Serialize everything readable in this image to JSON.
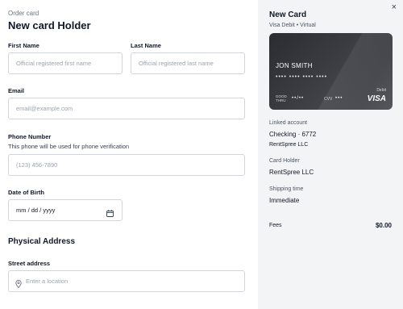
{
  "form": {
    "breadcrumb": "Order card",
    "title": "New card Holder",
    "first_name": {
      "label": "First Name",
      "placeholder": "Official registered first name"
    },
    "last_name": {
      "label": "Last Name",
      "placeholder": "Official registered last name"
    },
    "email": {
      "label": "Email",
      "placeholder": "email@example.com"
    },
    "phone": {
      "label": "Phone Number",
      "help": "This phone will be used for phone verification",
      "placeholder": "(123) 456-7890"
    },
    "dob": {
      "label": "Date of Birth",
      "value": "mm / dd / yyyy",
      "icon": "calendar-icon"
    },
    "address_section": "Physical Address",
    "street": {
      "label": "Street address",
      "placeholder": "Enter a location",
      "icon": "location-pin-icon"
    }
  },
  "summary": {
    "close_glyph": "×",
    "title": "New Card",
    "subtitle": "Visa Debit • Virtual",
    "card": {
      "holder": "JON SMITH",
      "number": "•••• •••• •••• ••••",
      "type": "Debit",
      "good_thru_label": "GOOD\nTHRU",
      "expiry": "••/••",
      "cvv_label": "CVV",
      "cvv": "•••",
      "brand": "VISA"
    },
    "linked_account_label": "Linked account",
    "linked_account_value": "Checking · 6772",
    "linked_account_org": "RentSpree LLC",
    "card_holder_label": "Card Holder",
    "card_holder_value": "RentSpree LLC",
    "shipping_label": "Shipping time",
    "shipping_value": "Immediate",
    "fees_label": "Fees",
    "fees_value": "$0.00"
  }
}
